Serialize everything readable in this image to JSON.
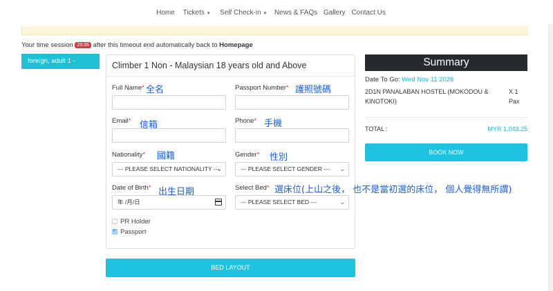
{
  "nav": {
    "items": [
      {
        "label": "Home",
        "dropdown": false
      },
      {
        "label": "Tickets",
        "dropdown": true
      },
      {
        "label": "Self Check-in",
        "dropdown": true
      },
      {
        "label": "News & FAQs",
        "dropdown": false
      },
      {
        "label": "Gallery",
        "dropdown": false
      },
      {
        "label": "Contact Us",
        "dropdown": false
      }
    ]
  },
  "session": {
    "prefix": "Your time session",
    "timer": "29:35",
    "middle": "after this timeout end automatically back to",
    "link": "Homepage"
  },
  "guest_tab": {
    "label": "foreign, adult 1 -"
  },
  "form": {
    "title": "Climber 1 Non - Malaysian 18 years old and Above",
    "full_name": {
      "label": "Full Name",
      "note": "全名",
      "value": ""
    },
    "passport": {
      "label": "Passport Number",
      "note": "護照號碼",
      "value": ""
    },
    "email": {
      "label": "Email",
      "note": "信箱",
      "value": ""
    },
    "phone": {
      "label": "Phone",
      "note": "手機",
      "value": ""
    },
    "nationality": {
      "label": "Nationality",
      "note": "國籍",
      "value": "--- PLEASE SELECT NATIONALITY ---"
    },
    "gender": {
      "label": "Gender",
      "note": "性別",
      "value": "--- PLEASE SELECT GENDER ---"
    },
    "dob": {
      "label": "Date of Birth",
      "note": "出生日期",
      "value": "年 /月/日"
    },
    "bed": {
      "label": "Select Bed",
      "note": "選床位(上山之後， 也不是當初選的床位， 個人覺得無所謂)",
      "value": "--- PLEASE SELECT BED ---"
    },
    "pr_holder": {
      "label": "PR Holder",
      "checked": false
    },
    "passport_check": {
      "label": "Passport",
      "checked": true
    },
    "required_mark": "*"
  },
  "bed_layout_button": "BED LAYOUT",
  "summary": {
    "title": "Summary",
    "date_label": "Date To Go:",
    "date_value": "Wed Nov 11 2026",
    "item": "2D1N PANALABAN HOSTEL (MOKODOU & KINOTOKI)",
    "qty": "X 1 Pax",
    "total_label": "TOTAL :",
    "total_value": "MYR 1,043.25",
    "book_button": "BOOK NOW"
  },
  "colors": {
    "accent": "#1fc3df",
    "timer": "#dc3545",
    "annotation": "#1a5fd6",
    "summary_header": "#262a2e",
    "banner": "#fcf4d6"
  }
}
